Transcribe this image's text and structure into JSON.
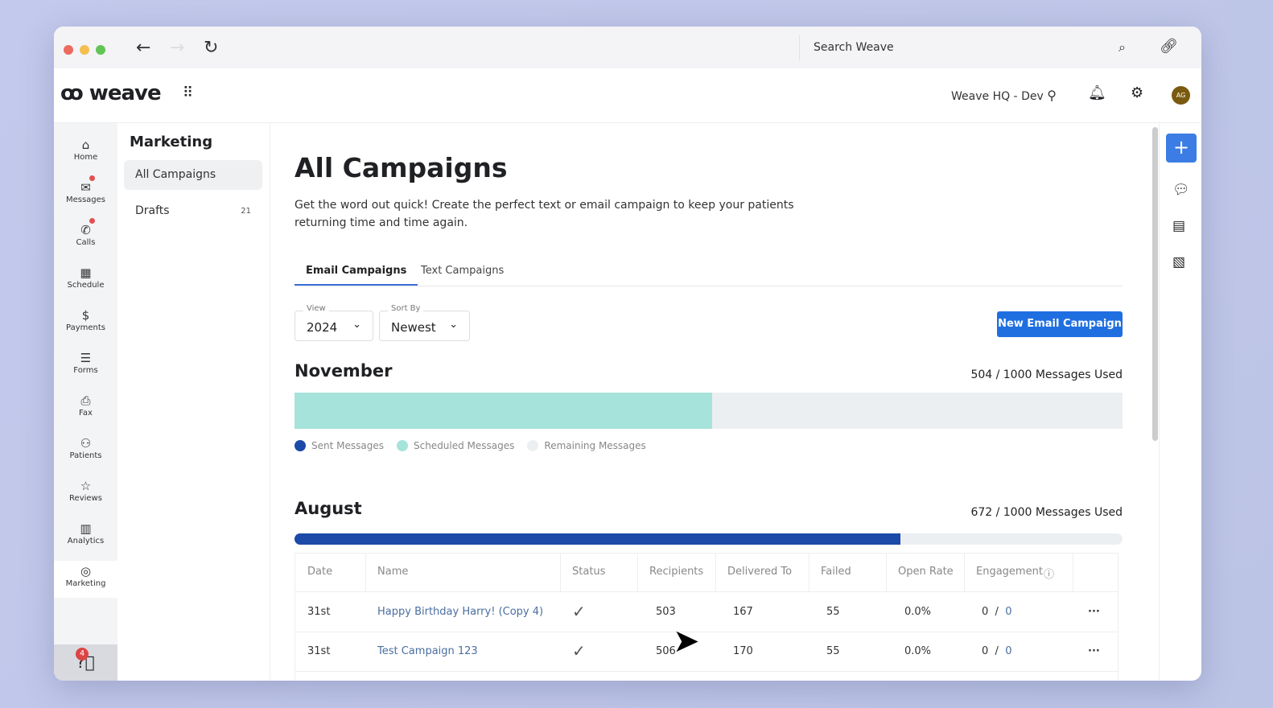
{
  "browser": {
    "search_placeholder": "Search Weave",
    "dots": [
      "#ec6b5e",
      "#f4bf4f",
      "#61c554"
    ]
  },
  "header": {
    "logo": "ꝏ weave",
    "location": "Weave HQ - Dev",
    "avatar": "AG"
  },
  "leftnav": [
    {
      "label": "Home",
      "icon": "⌂"
    },
    {
      "label": "Messages",
      "icon": "✉",
      "badge": true
    },
    {
      "label": "Calls",
      "icon": "✆",
      "badge": true
    },
    {
      "label": "Schedule",
      "icon": "▦"
    },
    {
      "label": "Payments",
      "icon": "$"
    },
    {
      "label": "Forms",
      "icon": "☰"
    },
    {
      "label": "Fax",
      "icon": "⎙"
    },
    {
      "label": "Patients",
      "icon": "⚇"
    },
    {
      "label": "Reviews",
      "icon": "☆"
    },
    {
      "label": "Analytics",
      "icon": "▥"
    },
    {
      "label": "Marketing",
      "icon": "◎",
      "active": true
    }
  ],
  "help": {
    "badge": "4"
  },
  "sidebar": {
    "title": "Marketing",
    "items": [
      {
        "label": "All Campaigns",
        "active": true
      },
      {
        "label": "Drafts",
        "count": "21"
      }
    ]
  },
  "main": {
    "title": "All Campaigns",
    "description": "Get the word out quick! Create the perfect text or email campaign to keep your patients returning time and time again.",
    "tabs": [
      "Email Campaigns",
      "Text Campaigns"
    ],
    "view": {
      "label": "View",
      "value": "2024"
    },
    "sort": {
      "label": "Sort By",
      "value": "Newest"
    },
    "new_button": "New Email Campaign",
    "months": [
      {
        "name": "November",
        "used": "504 / 1000 Messages Used",
        "sent_fraction": 0,
        "scheduled_fraction": 0.504
      },
      {
        "name": "August",
        "used": "672 / 1000 Messages Used",
        "sent_fraction": 0.732,
        "scheduled_fraction": 0
      }
    ],
    "legend": [
      {
        "label": "Sent Messages",
        "color": "#1b4aa8"
      },
      {
        "label": "Scheduled Messages",
        "color": "#a6e3da"
      },
      {
        "label": "Remaining Messages",
        "color": "#eceff1"
      }
    ],
    "table": {
      "columns": [
        "Date",
        "Name",
        "Status",
        "Recipients",
        "Delivered To",
        "Failed",
        "Open Rate",
        "Engagement"
      ],
      "rows": [
        {
          "date": "31st",
          "name": "Happy Birthday Harry! (Copy 4)",
          "status": "✓",
          "recipients": "503",
          "delivered": "167",
          "failed": "55",
          "open_rate": "0.0%",
          "eng_a": "0",
          "eng_b": "0"
        },
        {
          "date": "31st",
          "name": "Test Campaign 123",
          "status": "✓",
          "recipients": "506",
          "delivered": "170",
          "failed": "55",
          "open_rate": "0.0%",
          "eng_a": "0",
          "eng_b": "0"
        }
      ]
    }
  },
  "colors": {
    "primary": "#1f6fe0",
    "sent": "#1b4aa8",
    "scheduled": "#a6e3da"
  }
}
